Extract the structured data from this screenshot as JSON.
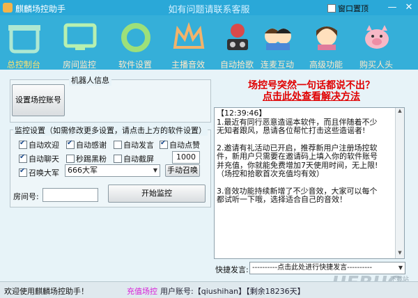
{
  "window": {
    "app_title": "麒麟场控助手",
    "center_title": "如有问题请联系客服",
    "pin_label": "窗口置顶",
    "minimize": "—",
    "close": "✕"
  },
  "nav": [
    {
      "label": "总控制台",
      "icon": "store-icon"
    },
    {
      "label": "房间监控",
      "icon": "monitor-icon"
    },
    {
      "label": "软件设置",
      "icon": "settings-ring-icon"
    },
    {
      "label": "主播音效",
      "icon": "crown-icon"
    },
    {
      "label": "自动拾歌",
      "icon": "dj-icon"
    },
    {
      "label": "连麦互动",
      "icon": "cartoon-kids-icon"
    },
    {
      "label": "高级功能",
      "icon": "cartoon-girl-icon"
    },
    {
      "label": "购买人头",
      "icon": "pig-icon"
    }
  ],
  "robot": {
    "legend": "机器人信息",
    "set_account_button": "设置场控账号"
  },
  "monitor": {
    "legend": "监控设置（如需修改更多设置，请点击上方的软件设置）",
    "checkboxes": [
      {
        "label": "自动欢迎",
        "checked": true
      },
      {
        "label": "自动感谢",
        "checked": true
      },
      {
        "label": "自动发言",
        "checked": false
      },
      {
        "label": "自动点赞",
        "checked": true
      },
      {
        "label": "自动聊天",
        "checked": true
      },
      {
        "label": "秒踢黑粉",
        "checked": false
      },
      {
        "label": "自动截屏",
        "checked": false
      },
      {
        "label": "召唤大军",
        "checked": true
      }
    ],
    "like_count": "1000",
    "army_select": "666大军",
    "manual_summon_button": "手动召唤"
  },
  "room": {
    "label": "房间号:",
    "value": "",
    "start_button": "开始监控"
  },
  "notice": {
    "line1": "场控号突然一句话都说不出？",
    "line2": "点击此处查看解决方法"
  },
  "message_box": {
    "timestamp": "【12:39:46】",
    "lines": [
      "1.最近有同行恶意造谣本软件，而且伴随着不少",
      "无知者跟风，恳请各位帮忙打击这些造谣者!",
      "",
      "2.邀请有礼活动已开启，推荐新用户注册场控软",
      "件，新用户只需要在邀请码上填入你的软件账号",
      "并充值，你就能免费增加7天使用时间，无上限!",
      "（场控和拾歌首次充值均有效）",
      "",
      "3.音效功能持续新增了不少音效，大家可以每个",
      "都试听一下哦，选择适合自己的音效！"
    ]
  },
  "quick": {
    "label": "快捷发言:",
    "select": "----------点击此处进行快捷发言----------"
  },
  "status": {
    "welcome": "欢迎使用麒麟场控助手！",
    "recharge": "充值场控",
    "account": "用户账号:【qiushihan】【剩余18236天】"
  },
  "watermark": {
    "main": "UEBUG",
    "sub": "下载站"
  }
}
